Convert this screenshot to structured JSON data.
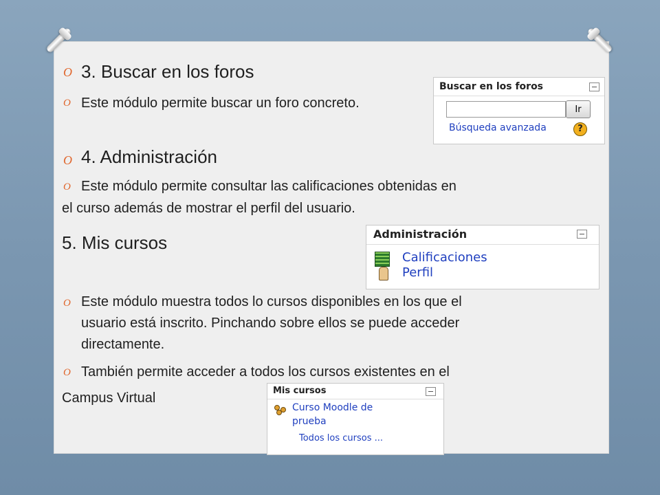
{
  "slide": {
    "section3_title": "3. Buscar en los foros",
    "section3_text": "Este módulo permite buscar un foro concreto.",
    "section4_title": "4. Administración",
    "section4_text_line1": "Este módulo permite consultar las calificaciones obtenidas en",
    "section4_text_line2": "el curso además de mostrar el perfil del usuario.",
    "section5_title": "5. Mis cursos",
    "section5_text_line1": "Este módulo muestra todos lo cursos disponibles en los que el",
    "section5_text_line2": "usuario está inscrito. Pinchando sobre ellos se puede acceder",
    "section5_text_line3": "directamente.",
    "section5_text2_line1": "También permite acceder a todos los cursos existentes en el",
    "section5_text2_line2": "Campus Virtual",
    "bullet_glyph": "O"
  },
  "buscar_widget": {
    "title": "Buscar en los foros",
    "search_value": "",
    "go_button": "Ir",
    "advanced_link": "Búsqueda avanzada",
    "help_glyph": "?"
  },
  "admin_widget": {
    "title": "Administración",
    "items": [
      "Calificaciones",
      "Perfil"
    ]
  },
  "cursos_widget": {
    "title": "Mis cursos",
    "course_line1": "Curso Moodle de",
    "course_line2": "prueba",
    "all_link": "Todos los cursos ..."
  },
  "colors": {
    "bullet": "#e0662c",
    "link": "#1f3fbf",
    "background": "#7b97b1",
    "board": "#efefef"
  }
}
